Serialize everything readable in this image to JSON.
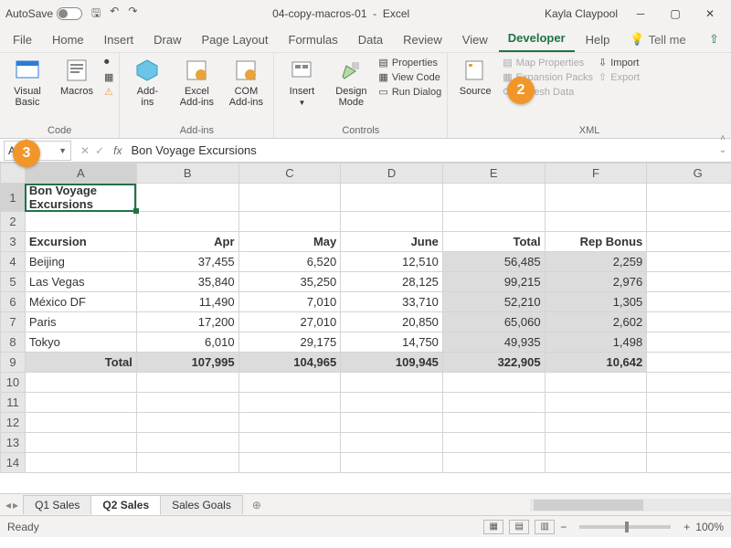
{
  "titlebar": {
    "autosave": "AutoSave",
    "filename": "04-copy-macros-01",
    "appname": "Excel",
    "user": "Kayla Claypool"
  },
  "tabs": [
    "File",
    "Home",
    "Insert",
    "Draw",
    "Page Layout",
    "Formulas",
    "Data",
    "Review",
    "View",
    "Developer",
    "Help"
  ],
  "active_tab": "Developer",
  "tellme": "Tell me",
  "ribbon": {
    "code": {
      "label": "Code",
      "visual_basic": "Visual Basic",
      "macros": "Macros"
    },
    "addins": {
      "label": "Add-ins",
      "addins": "Add-\nins",
      "excel": "Excel\nAdd-ins",
      "com": "COM\nAdd-ins"
    },
    "controls": {
      "label": "Controls",
      "insert": "Insert",
      "design": "Design\nMode",
      "properties": "Properties",
      "view_code": "View Code",
      "run_dialog": "Run Dialog"
    },
    "xml": {
      "label": "XML",
      "source": "Source",
      "map_props": "Map Properties",
      "exp_packs": "Expansion Packs",
      "refresh": "Refresh Data",
      "import": "Import",
      "export": "Export"
    }
  },
  "namebox": "A1",
  "formula": "Bon Voyage Excursions",
  "columns": [
    "A",
    "B",
    "C",
    "D",
    "E",
    "F",
    "G"
  ],
  "rows": [
    "1",
    "2",
    "3",
    "4",
    "5",
    "6",
    "7",
    "8",
    "9",
    "10",
    "11",
    "12",
    "13",
    "14"
  ],
  "data": {
    "r1": {
      "A": "Bon Voyage Excursions"
    },
    "r3": {
      "A": "Excursion",
      "B": "Apr",
      "C": "May",
      "D": "June",
      "E": "Total",
      "F": "Rep Bonus"
    },
    "r4": {
      "A": "Beijing",
      "B": "37,455",
      "C": "6,520",
      "D": "12,510",
      "E": "56,485",
      "F": "2,259"
    },
    "r5": {
      "A": "Las Vegas",
      "B": "35,840",
      "C": "35,250",
      "D": "28,125",
      "E": "99,215",
      "F": "2,976"
    },
    "r6": {
      "A": "México DF",
      "B": "11,490",
      "C": "7,010",
      "D": "33,710",
      "E": "52,210",
      "F": "1,305"
    },
    "r7": {
      "A": "Paris",
      "B": "17,200",
      "C": "27,010",
      "D": "20,850",
      "E": "65,060",
      "F": "2,602"
    },
    "r8": {
      "A": "Tokyo",
      "B": "6,010",
      "C": "29,175",
      "D": "14,750",
      "E": "49,935",
      "F": "1,498"
    },
    "r9": {
      "A": "Total",
      "B": "107,995",
      "C": "104,965",
      "D": "109,945",
      "E": "322,905",
      "F": "10,642"
    }
  },
  "sheet_tabs": [
    "Q1 Sales",
    "Q2 Sales",
    "Sales Goals"
  ],
  "active_sheet": "Q2 Sales",
  "status": {
    "ready": "Ready",
    "zoom": "100%"
  },
  "callouts": {
    "b2": "2",
    "b3": "3"
  }
}
